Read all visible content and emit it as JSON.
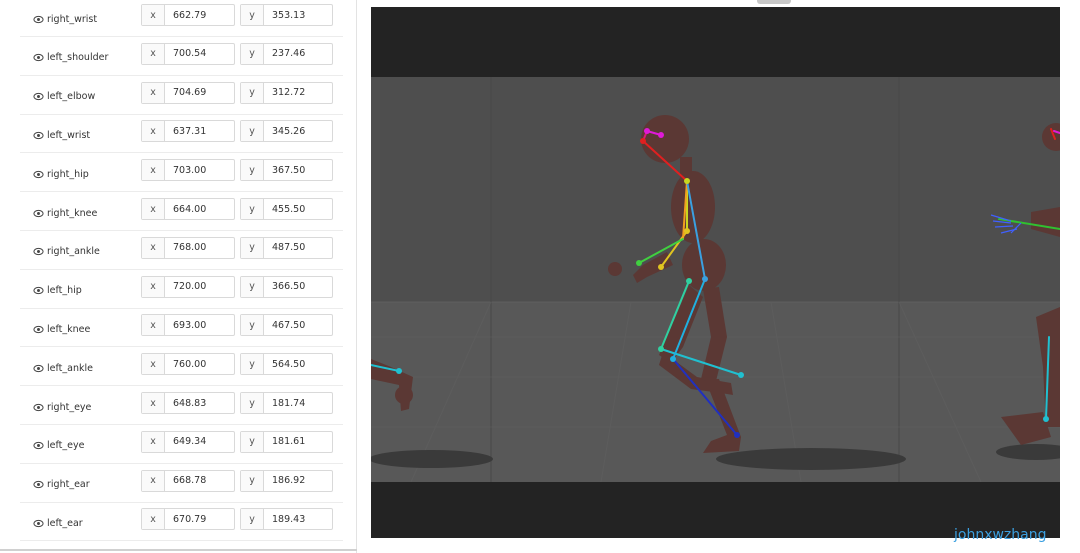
{
  "keypoints": [
    {
      "name": "right_wrist",
      "x": "662.79",
      "y": "353.13"
    },
    {
      "name": "left_shoulder",
      "x": "700.54",
      "y": "237.46"
    },
    {
      "name": "left_elbow",
      "x": "704.69",
      "y": "312.72"
    },
    {
      "name": "left_wrist",
      "x": "637.31",
      "y": "345.26"
    },
    {
      "name": "right_hip",
      "x": "703.00",
      "y": "367.50"
    },
    {
      "name": "right_knee",
      "x": "664.00",
      "y": "455.50"
    },
    {
      "name": "right_ankle",
      "x": "768.00",
      "y": "487.50"
    },
    {
      "name": "left_hip",
      "x": "720.00",
      "y": "366.50"
    },
    {
      "name": "left_knee",
      "x": "693.00",
      "y": "467.50"
    },
    {
      "name": "left_ankle",
      "x": "760.00",
      "y": "564.50"
    },
    {
      "name": "right_eye",
      "x": "648.83",
      "y": "181.74"
    },
    {
      "name": "left_eye",
      "x": "649.34",
      "y": "181.61"
    },
    {
      "name": "right_ear",
      "x": "668.78",
      "y": "186.92"
    },
    {
      "name": "left_ear",
      "x": "670.79",
      "y": "189.43"
    }
  ],
  "axis_labels": {
    "x": "x",
    "y": "y"
  },
  "watermark": "johnxwzhang",
  "colors": {
    "accent": "#3ba0e0",
    "scene_bg": "#444444"
  }
}
